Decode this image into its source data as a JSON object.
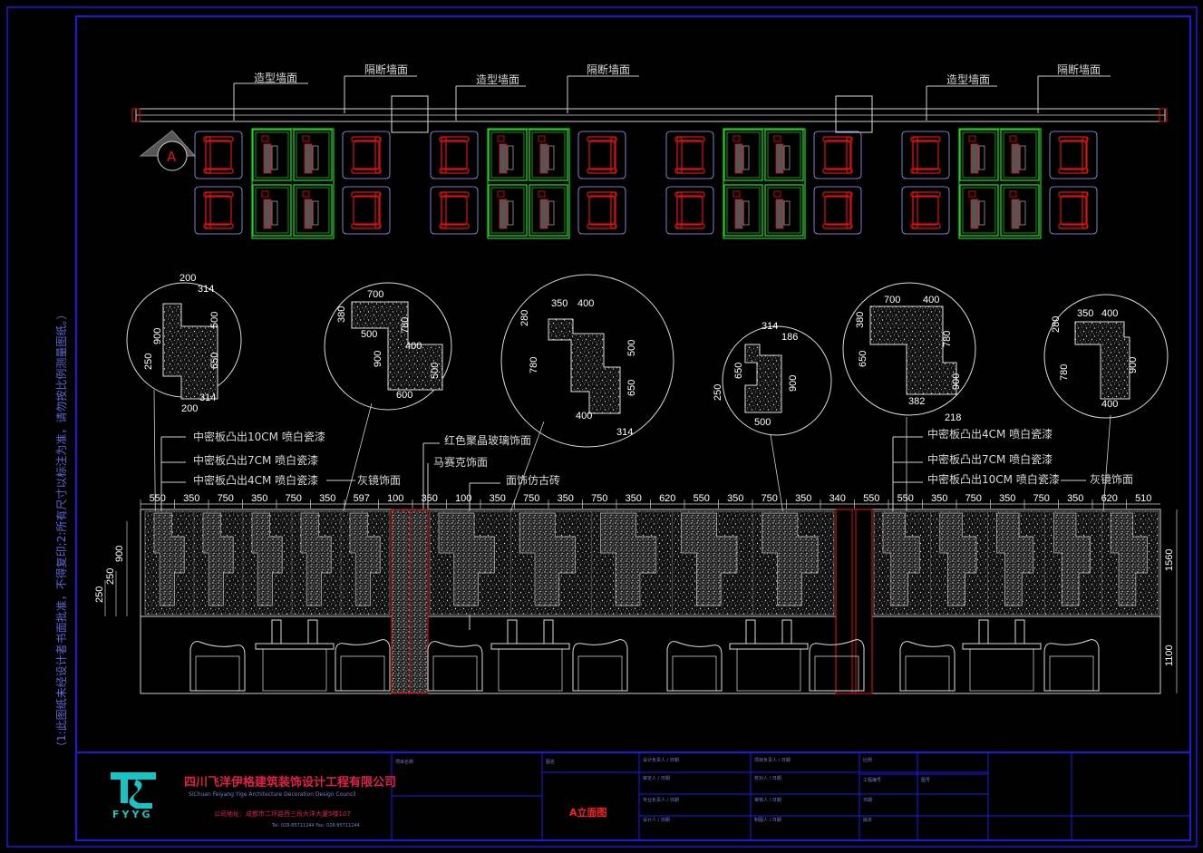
{
  "plan": {
    "labels_top": [
      "造型墙面",
      "隔断墙面",
      "造型墙面",
      "隔断墙面",
      "造型墙面",
      "隔断墙面"
    ],
    "marker": "A"
  },
  "details": [
    {
      "dims": [
        "200",
        "314",
        "900",
        "500",
        "250",
        "650",
        "314",
        "200"
      ]
    },
    {
      "dims": [
        "700",
        "380",
        "500",
        "780",
        "900",
        "400",
        "500",
        "600"
      ]
    },
    {
      "dims": [
        "350",
        "400",
        "280",
        "780",
        "500",
        "650",
        "400",
        "314"
      ]
    },
    {
      "dims": [
        "314",
        "186",
        "250",
        "650",
        "900",
        "500"
      ]
    },
    {
      "dims": [
        "700",
        "400",
        "380",
        "780",
        "650",
        "900",
        "382",
        "218"
      ]
    },
    {
      "dims": [
        "280",
        "350",
        "400",
        "780",
        "900",
        "400"
      ]
    }
  ],
  "callouts": {
    "left": [
      "中密板凸出10CM 喷白瓷漆",
      "中密板凸出7CM 喷白瓷漆",
      "中密板凸出4CM 喷白瓷漆",
      "灰镜饰面"
    ],
    "center": [
      "红色聚晶玻璃饰面",
      "马赛克饰面",
      "面饰仿古砖"
    ],
    "right": [
      "中密板凸出4CM 喷白瓷漆",
      "中密板凸出7CM 喷白瓷漆",
      "中密板凸出10CM 喷白瓷漆",
      "灰镜饰面"
    ]
  },
  "elevation": {
    "top_dims": [
      "550",
      "350",
      "750",
      "350",
      "750",
      "350",
      "597",
      "100",
      "350",
      "100",
      "350",
      "750",
      "350",
      "750",
      "350",
      "620",
      "550",
      "350",
      "750",
      "350",
      "340",
      "550",
      "550",
      "350",
      "750",
      "350",
      "750",
      "350",
      "620",
      "510"
    ],
    "left_dims": [
      "900",
      "250",
      "250"
    ],
    "right_dims": [
      "1560",
      "1100"
    ]
  },
  "side_note": "（1:此图纸未经设计者书面批准，不得复印;2:所有尺寸以标注为准，请勿按比例测量图纸。）",
  "title_block": {
    "logo_text": "FYYG",
    "company_cn": "四川飞洋伊格建筑装饰设计工程有限公司",
    "company_en": "SiChuan Feiyang Yige Architecture Decoration Design Council",
    "address": "公司地址：成都市二环路西三段大洋大厦5楼107",
    "phone": "Tel: 028-85711244  Fax: 028-85711244",
    "drawing_title": "A立面图",
    "cells": [
      "项目名称",
      "图名",
      "设计负责人 / 日期",
      "项目负责人 / 日期",
      "比例",
      "审定人 / 日期",
      "校对人 / 日期",
      "工程编号",
      "图号",
      "专业负责人 / 日期",
      "审核人 / 日期",
      "日期",
      "设计人 / 日期",
      "制图人 / 日期",
      "版本"
    ]
  },
  "colors": {
    "frame": "#1a1ae6",
    "chair": "#e01010",
    "table": "#1fd21f",
    "logo": "#19c3c3",
    "company": "#e0204a",
    "title": "#ff2020",
    "partition": "#c81414"
  }
}
